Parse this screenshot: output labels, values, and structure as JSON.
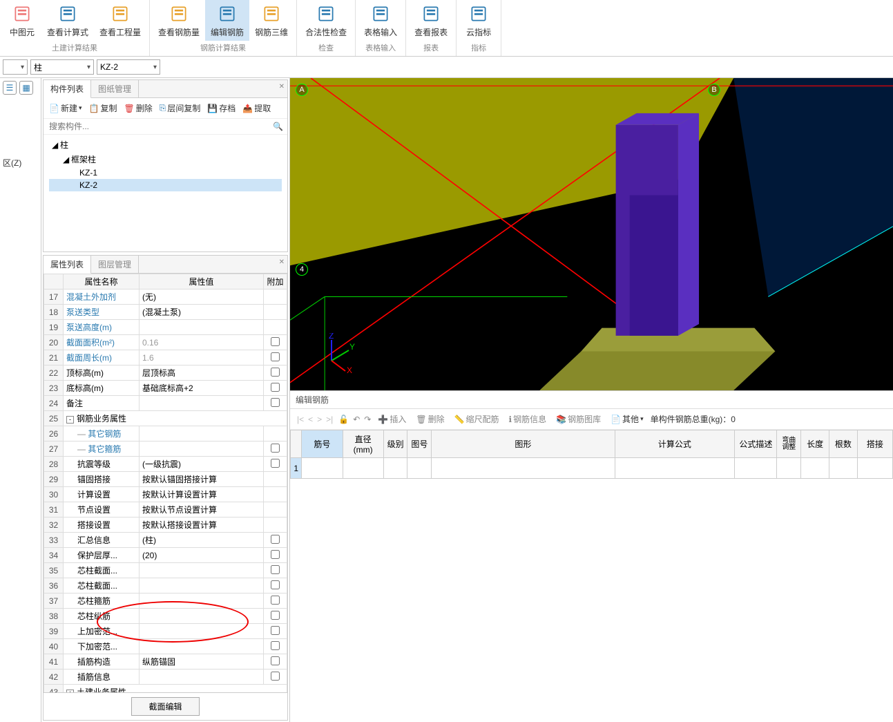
{
  "ribbon": {
    "groups": [
      {
        "label": "土建计算结果",
        "items": [
          {
            "id": "sel-elem",
            "label": "中图元"
          },
          {
            "id": "view-calc",
            "label": "查看计算式"
          },
          {
            "id": "view-qty",
            "label": "查看工程量"
          }
        ]
      },
      {
        "label": "钢筋计算结果",
        "items": [
          {
            "id": "view-rebar",
            "label": "查看钢筋量"
          },
          {
            "id": "edit-rebar",
            "label": "编辑钢筋",
            "active": true
          },
          {
            "id": "rebar-3d",
            "label": "钢筋三维"
          }
        ]
      },
      {
        "label": "检查",
        "items": [
          {
            "id": "validity",
            "label": "合法性检查"
          }
        ]
      },
      {
        "label": "表格输入",
        "items": [
          {
            "id": "table-input",
            "label": "表格输入"
          }
        ]
      },
      {
        "label": "报表",
        "items": [
          {
            "id": "view-report",
            "label": "查看报表"
          }
        ]
      },
      {
        "label": "指标",
        "items": [
          {
            "id": "cloud-index",
            "label": "云指标"
          }
        ]
      }
    ]
  },
  "dropdowns": {
    "d1": "",
    "d2": "柱",
    "d3": "KZ-2"
  },
  "leftStrip": {
    "label": "区(Z)"
  },
  "componentPanel": {
    "tabs": {
      "active": "构件列表",
      "inactive": "图纸管理"
    },
    "toolbar": {
      "new": "新建",
      "copy": "复制",
      "del": "删除",
      "floorcopy": "层间复制",
      "archive": "存档",
      "extract": "提取"
    },
    "searchPlaceholder": "搜索构件...",
    "tree": {
      "root": "柱",
      "sub": "框架柱",
      "items": [
        "KZ-1",
        "KZ-2"
      ],
      "selected": "KZ-2"
    }
  },
  "propertyPanel": {
    "tabs": {
      "active": "属性列表",
      "inactive": "图层管理"
    },
    "headers": {
      "name": "属性名称",
      "value": "属性值",
      "extra": "附加"
    },
    "rows": [
      {
        "n": 17,
        "name": "混凝土外加剂",
        "blue": true,
        "value": "(无)"
      },
      {
        "n": 18,
        "name": "泵送类型",
        "blue": true,
        "value": "(混凝土泵)"
      },
      {
        "n": 19,
        "name": "泵送高度(m)",
        "blue": true,
        "value": ""
      },
      {
        "n": 20,
        "name": "截面面积(m²)",
        "blue": true,
        "value": "0.16",
        "cb": true,
        "gray": true
      },
      {
        "n": 21,
        "name": "截面周长(m)",
        "blue": true,
        "value": "1.6",
        "cb": true,
        "gray": true
      },
      {
        "n": 22,
        "name": "顶标高(m)",
        "value": "层顶标高",
        "cb": true
      },
      {
        "n": 23,
        "name": "底标高(m)",
        "value": "基础底标高+2",
        "cb": true
      },
      {
        "n": 24,
        "name": "备注",
        "value": "",
        "cb": true
      },
      {
        "n": 25,
        "name": "钢筋业务属性",
        "group": true,
        "exp": "-"
      },
      {
        "n": 26,
        "name": "其它钢筋",
        "indent": true,
        "blue": true,
        "pipe": true
      },
      {
        "n": 27,
        "name": "其它箍筋",
        "indent": true,
        "blue": true,
        "pipe": true,
        "cb": true
      },
      {
        "n": 28,
        "name": "抗震等级",
        "indent": true,
        "value": "(一级抗震)",
        "cb": true
      },
      {
        "n": 29,
        "name": "锚固搭接",
        "indent": true,
        "value": "按默认锚固搭接计算"
      },
      {
        "n": 30,
        "name": "计算设置",
        "indent": true,
        "value": "按默认计算设置计算"
      },
      {
        "n": 31,
        "name": "节点设置",
        "indent": true,
        "value": "按默认节点设置计算"
      },
      {
        "n": 32,
        "name": "搭接设置",
        "indent": true,
        "value": "按默认搭接设置计算"
      },
      {
        "n": 33,
        "name": "汇总信息",
        "indent": true,
        "value": "(柱)",
        "cb": true
      },
      {
        "n": 34,
        "name": "保护层厚...",
        "indent": true,
        "value": "(20)",
        "cb": true
      },
      {
        "n": 35,
        "name": "芯柱截面...",
        "indent": true,
        "cb": true
      },
      {
        "n": 36,
        "name": "芯柱截面...",
        "indent": true,
        "cb": true
      },
      {
        "n": 37,
        "name": "芯柱箍筋",
        "indent": true,
        "cb": true
      },
      {
        "n": 38,
        "name": "芯柱纵筋",
        "indent": true,
        "cb": true
      },
      {
        "n": 39,
        "name": "上加密范...",
        "indent": true,
        "cb": true
      },
      {
        "n": 40,
        "name": "下加密范...",
        "indent": true,
        "cb": true
      },
      {
        "n": 41,
        "name": "插筋构造",
        "indent": true,
        "value": "纵筋锚固",
        "cb": true
      },
      {
        "n": 42,
        "name": "插筋信息",
        "indent": true,
        "cb": true
      },
      {
        "n": 43,
        "name": "土建业务属性",
        "group": true,
        "exp": "+"
      }
    ],
    "footerBtn": "截面编辑"
  },
  "viewport": {
    "markers": {
      "A": "A",
      "B": "B",
      "four": "4"
    },
    "axes": {
      "x": "X",
      "y": "Y",
      "z": "Z"
    }
  },
  "bottomEditor": {
    "title": "编辑钢筋",
    "toolbar": {
      "insert": "插入",
      "delete": "删除",
      "scale": "缩尺配筋",
      "info": "钢筋信息",
      "lib": "钢筋图库",
      "other": "其他",
      "total": "单构件钢筋总重(kg)：",
      "totalVal": "0"
    },
    "headers": [
      "筋号",
      "直径(mm)",
      "级别",
      "图号",
      "图形",
      "计算公式",
      "公式描述",
      "弯曲调整",
      "长度",
      "根数",
      "搭接"
    ],
    "rownum": "1"
  }
}
